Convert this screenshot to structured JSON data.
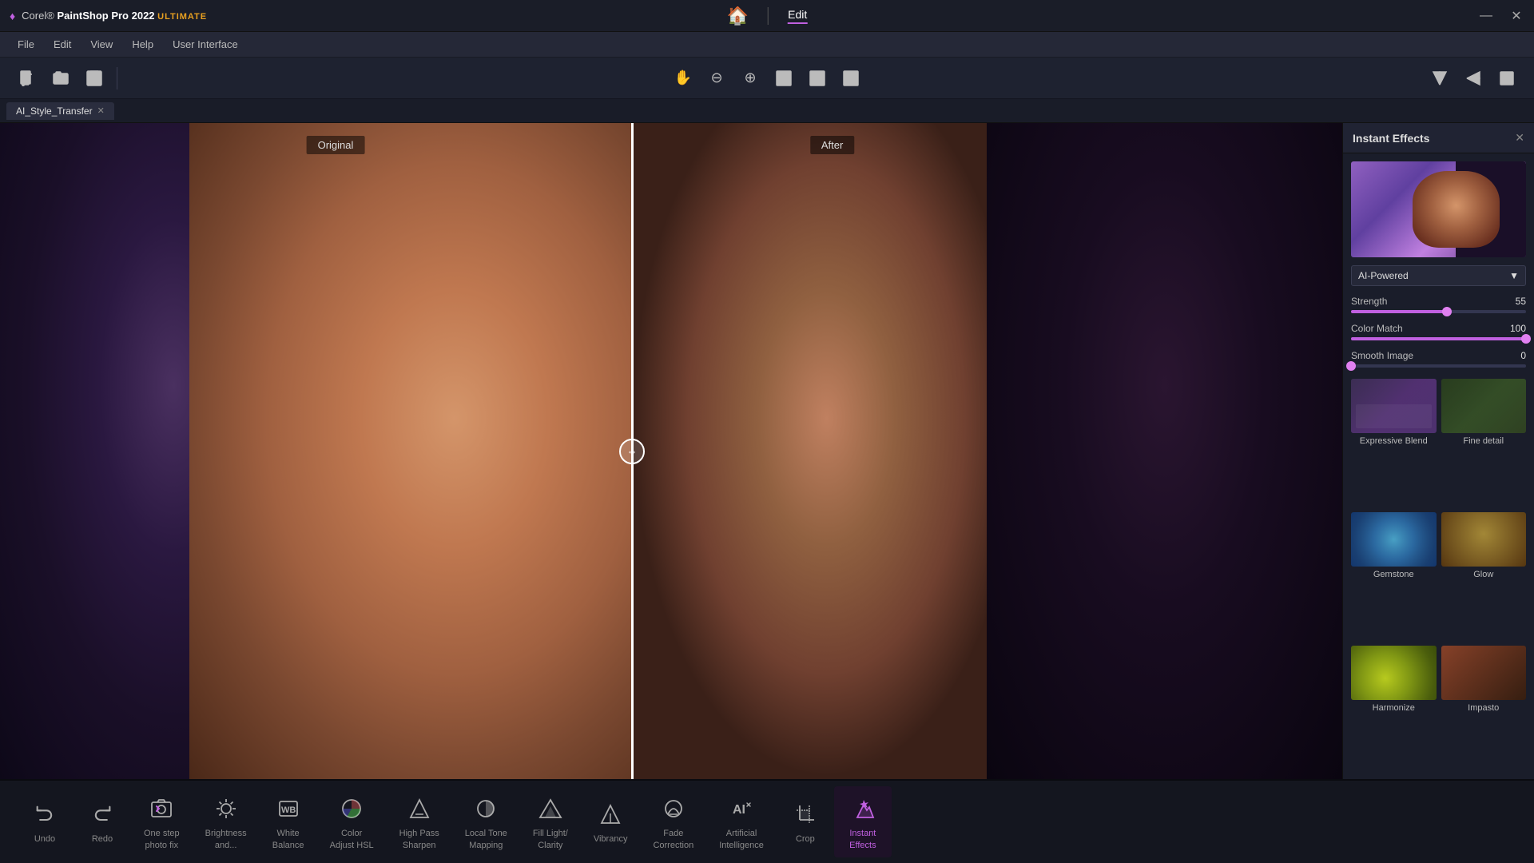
{
  "app": {
    "title_corel": "Corel®",
    "title_psp": "PaintShop Pro 2022",
    "title_ultimate": "ULTIMATE"
  },
  "titlebar": {
    "center_home": "🏠",
    "center_edit": "Edit",
    "minimize": "—",
    "close": "✕"
  },
  "menu": {
    "items": [
      "File",
      "Edit",
      "View",
      "Help",
      "User Interface"
    ]
  },
  "toolbar": {
    "tools": [
      "new",
      "open",
      "save"
    ]
  },
  "tab": {
    "name": "AI_Style_Transfer"
  },
  "canvas": {
    "label_original": "Original",
    "label_after": "After"
  },
  "instant_effects": {
    "panel_title": "Instant Effects",
    "close_btn": "✕",
    "dropdown_value": "AI-Powered",
    "strength_label": "Strength",
    "strength_value": "55",
    "color_match_label": "Color Match",
    "color_match_value": "100",
    "smooth_image_label": "Smooth Image",
    "smooth_image_value": "0",
    "effects": [
      {
        "name": "Expressive Blend",
        "thumb_class": "thumb-expressive"
      },
      {
        "name": "Fine detail",
        "thumb_class": "thumb-fine-detail"
      },
      {
        "name": "Gemstone",
        "thumb_class": "thumb-gemstone"
      },
      {
        "name": "Glow",
        "thumb_class": "thumb-glow"
      },
      {
        "name": "Harmonize",
        "thumb_class": "thumb-harmonize"
      },
      {
        "name": "Impasto",
        "thumb_class": "thumb-impasto"
      }
    ]
  },
  "bottom_tools": [
    {
      "id": "undo",
      "label": "Undo",
      "icon": "undo"
    },
    {
      "id": "redo",
      "label": "Redo",
      "icon": "redo"
    },
    {
      "id": "one-step-photo",
      "label": "One step\nphoto fix",
      "icon": "one-step"
    },
    {
      "id": "brightness",
      "label": "Brightness\nand...",
      "icon": "brightness"
    },
    {
      "id": "white-balance",
      "label": "White\nBalance",
      "icon": "wb"
    },
    {
      "id": "color-adjust",
      "label": "Color\nAdjust HSL",
      "icon": "color"
    },
    {
      "id": "high-pass",
      "label": "High Pass\nSharpen",
      "icon": "highpass"
    },
    {
      "id": "local-tone",
      "label": "Local Tone\nMapping",
      "icon": "tone"
    },
    {
      "id": "fill-light",
      "label": "Fill Light/\nClarity",
      "icon": "fill"
    },
    {
      "id": "vibrancy",
      "label": "Vibrancy",
      "icon": "vibrancy"
    },
    {
      "id": "fade-correction",
      "label": "Fade\nCorrection",
      "icon": "fade"
    },
    {
      "id": "artificial-intelligence",
      "label": "Artificial\nIntelligence",
      "icon": "ai"
    },
    {
      "id": "crop",
      "label": "Crop",
      "icon": "crop"
    },
    {
      "id": "instant-effects",
      "label": "Instant\nEffects",
      "icon": "instant",
      "active": true
    }
  ]
}
